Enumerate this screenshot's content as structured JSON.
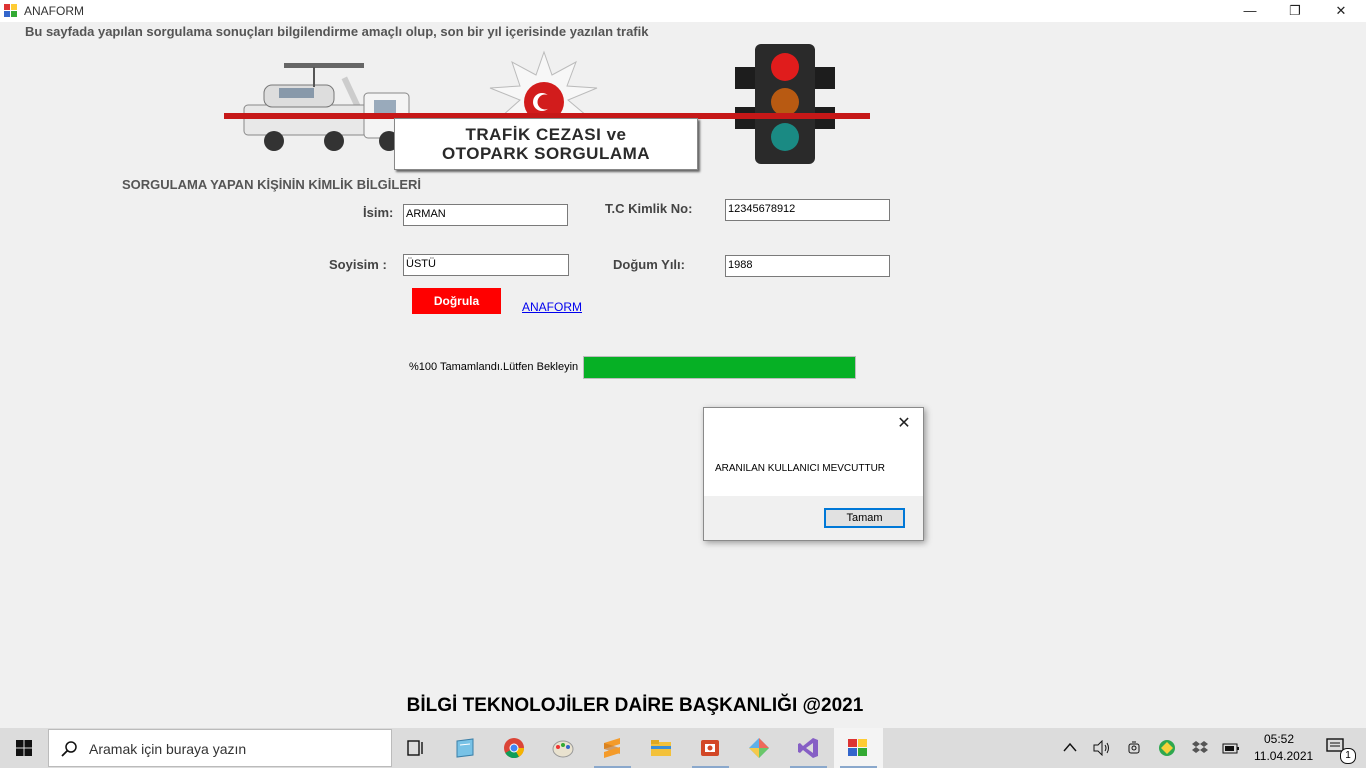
{
  "window": {
    "title": "ANAFORM",
    "minimize_glyph": "—",
    "restore_glyph": "❐",
    "close_glyph": "✕"
  },
  "content": {
    "info_text": "Bu sayfada yapılan sorgulama sonuçları bilgilendirme amaçlı olup, son bir yıl içerisinde yazılan trafik",
    "banner": {
      "line1": "TRAFİK CEZASI ve",
      "line2": "OTOPARK SORGULAMA"
    },
    "identity_heading": "SORGULAMA YAPAN KİŞİNİN KİMLİK BİLGİLERİ",
    "form": {
      "name_label": "İsim:",
      "name_value": "ARMAN",
      "surname_label": "Soyisim :",
      "surname_value": "ÜSTÜ",
      "tc_label": "T.C Kimlik No:",
      "tc_value": "12345678912",
      "birth_label": "Doğum Yılı:",
      "birth_value": "1988"
    },
    "verify_button": "Doğrula",
    "anaform_link": "ANAFORM",
    "progress": {
      "text": "%100 Tamamlandı.Lütfen Bekleyin",
      "percent": 100,
      "color": "#06b025"
    },
    "footer": "BİLGİ TEKNOLOJİLER DAİRE BAŞKANLIĞI @2021"
  },
  "dialog": {
    "message": "ARANILAN KULLANICI MEVCUTTUR",
    "ok_label": "Tamam",
    "close_glyph": "✕"
  },
  "taskbar": {
    "search_placeholder": "Aramak için buraya yazın",
    "pinned_icons": [
      "task-view-icon",
      "notepad-icon",
      "chrome-icon",
      "paint-icon",
      "sublime-icon",
      "file-explorer-icon",
      "powerpoint-icon",
      "ms-paint-3d-icon",
      "visual-studio-icon",
      "anaform-app-icon"
    ],
    "clock": {
      "time": "05:52",
      "date": "11.04.2021"
    },
    "notification_count": "1"
  },
  "colors": {
    "accent_red": "#ff0000",
    "banner_red": "#c61818",
    "progress_green": "#06b025",
    "focus_blue": "#0078d7"
  }
}
